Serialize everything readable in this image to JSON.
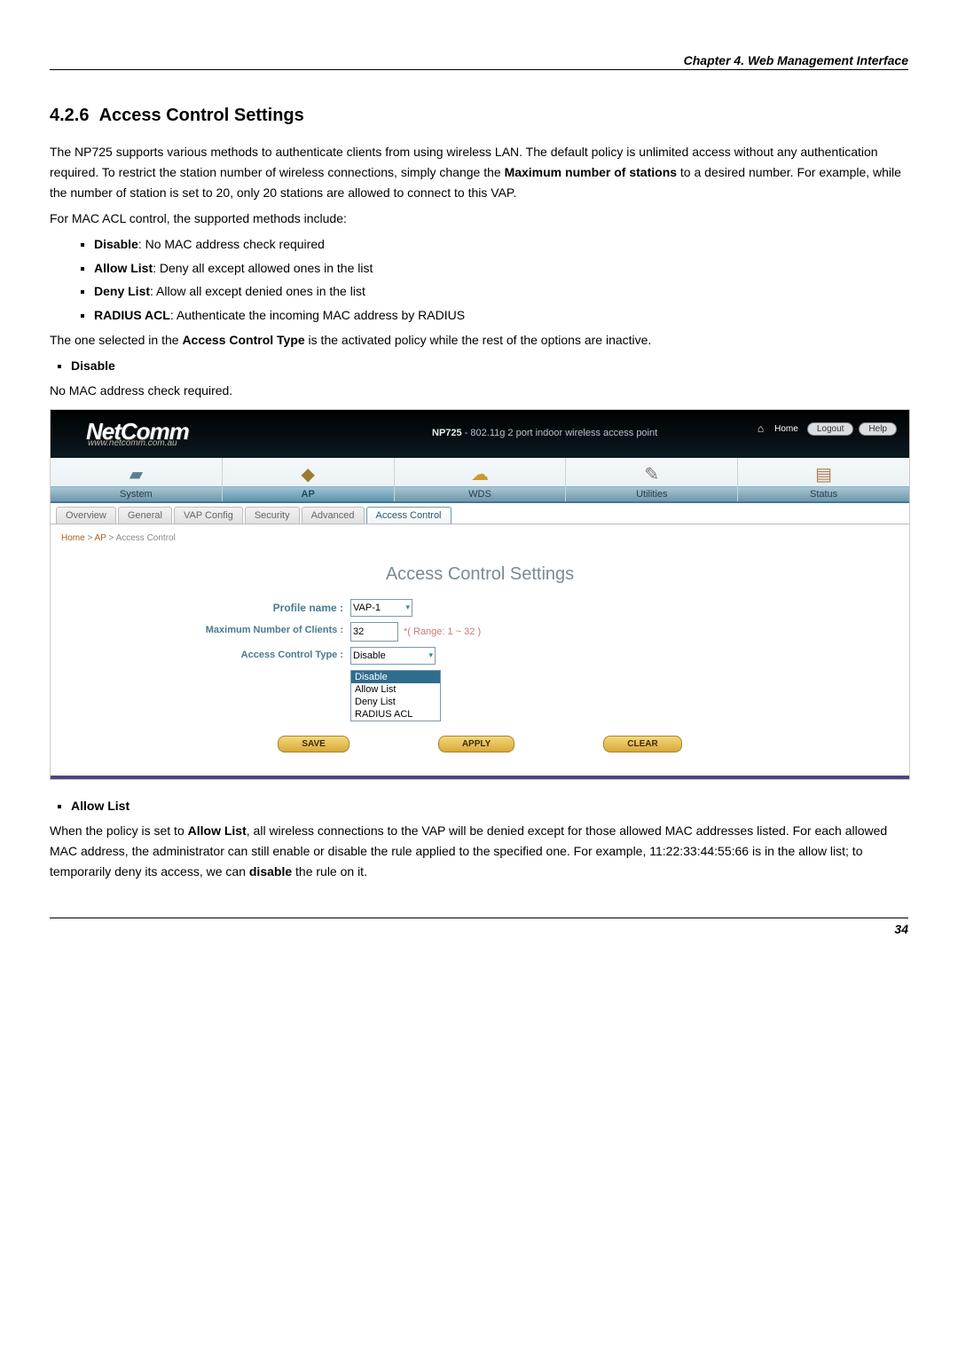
{
  "chapter": "Chapter 4. Web Management Interface",
  "section_no": "4.2.6",
  "section_title": "Access Control Settings",
  "intro_p1a": "The NP725 supports various methods to authenticate clients from using wireless LAN. The default policy is unlimited access without any authentication required. To restrict the station number of wireless connections, simply change the ",
  "intro_bold1": "Maximum number of stations",
  "intro_p1b": " to a desired number. For example, while the number of station is set to 20, only 20 stations are allowed to connect to this VAP.",
  "intro_p2": "For MAC ACL control, the supported methods include:",
  "methods": {
    "m0_b": "Disable",
    "m0_t": ": No MAC address check required",
    "m1_b": "Allow List",
    "m1_t": ": Deny all except allowed ones in the list",
    "m2_b": "Deny List",
    "m2_t": ": Allow all except denied ones in the list",
    "m3_b": "RADIUS ACL",
    "m3_t": ": Authenticate the incoming MAC address by RADIUS"
  },
  "selected_a": "The one selected in the ",
  "selected_bold": "Access Control Type",
  "selected_b": " is the activated policy while the rest of the options are inactive.",
  "disable_head": "Disable",
  "disable_sub": "No MAC address check required.",
  "ui": {
    "logo": "NetComm",
    "logo_sub": "www.netcomm.com.au",
    "product_model": "NP725",
    "product_desc": " - 802.11g 2 port indoor wireless access point",
    "home": "Home",
    "logout": "Logout",
    "help": "Help",
    "nav": [
      "System",
      "AP",
      "WDS",
      "Utilities",
      "Status"
    ],
    "nav_active": 1,
    "tabs": [
      "Overview",
      "General",
      "VAP Config",
      "Security",
      "Advanced",
      "Access Control"
    ],
    "tab_active": 5,
    "crumb": {
      "a": "Home",
      "b": "AP",
      "c": "Access Control"
    },
    "title": "Access Control Settings",
    "profile_label": "Profile name :",
    "profile_value": "VAP-1",
    "maxclients_label": "Maximum Number of Clients :",
    "maxclients_value": "32",
    "maxclients_range": "*( Range: 1 ~ 32 )",
    "actype_label": "Access Control Type :",
    "actype_value": "Disable",
    "dropdown": [
      "Disable",
      "Allow List",
      "Deny List",
      "RADIUS ACL"
    ],
    "btn_save": "SAVE",
    "btn_apply": "APPLY",
    "btn_clear": "CLEAR"
  },
  "allow_head": "Allow List",
  "allow_p_a": "When the policy is set to ",
  "allow_bold1": "Allow List",
  "allow_p_b": ", all wireless connections to the VAP will be denied except for those allowed MAC addresses listed. For each allowed MAC address, the administrator can still enable or disable the rule applied to the specified one. For example, 11:22:33:44:55:66 is in the allow list; to temporarily deny its access, we can ",
  "allow_bold2": "disable",
  "allow_p_c": " the rule on it.",
  "page_no": "34"
}
